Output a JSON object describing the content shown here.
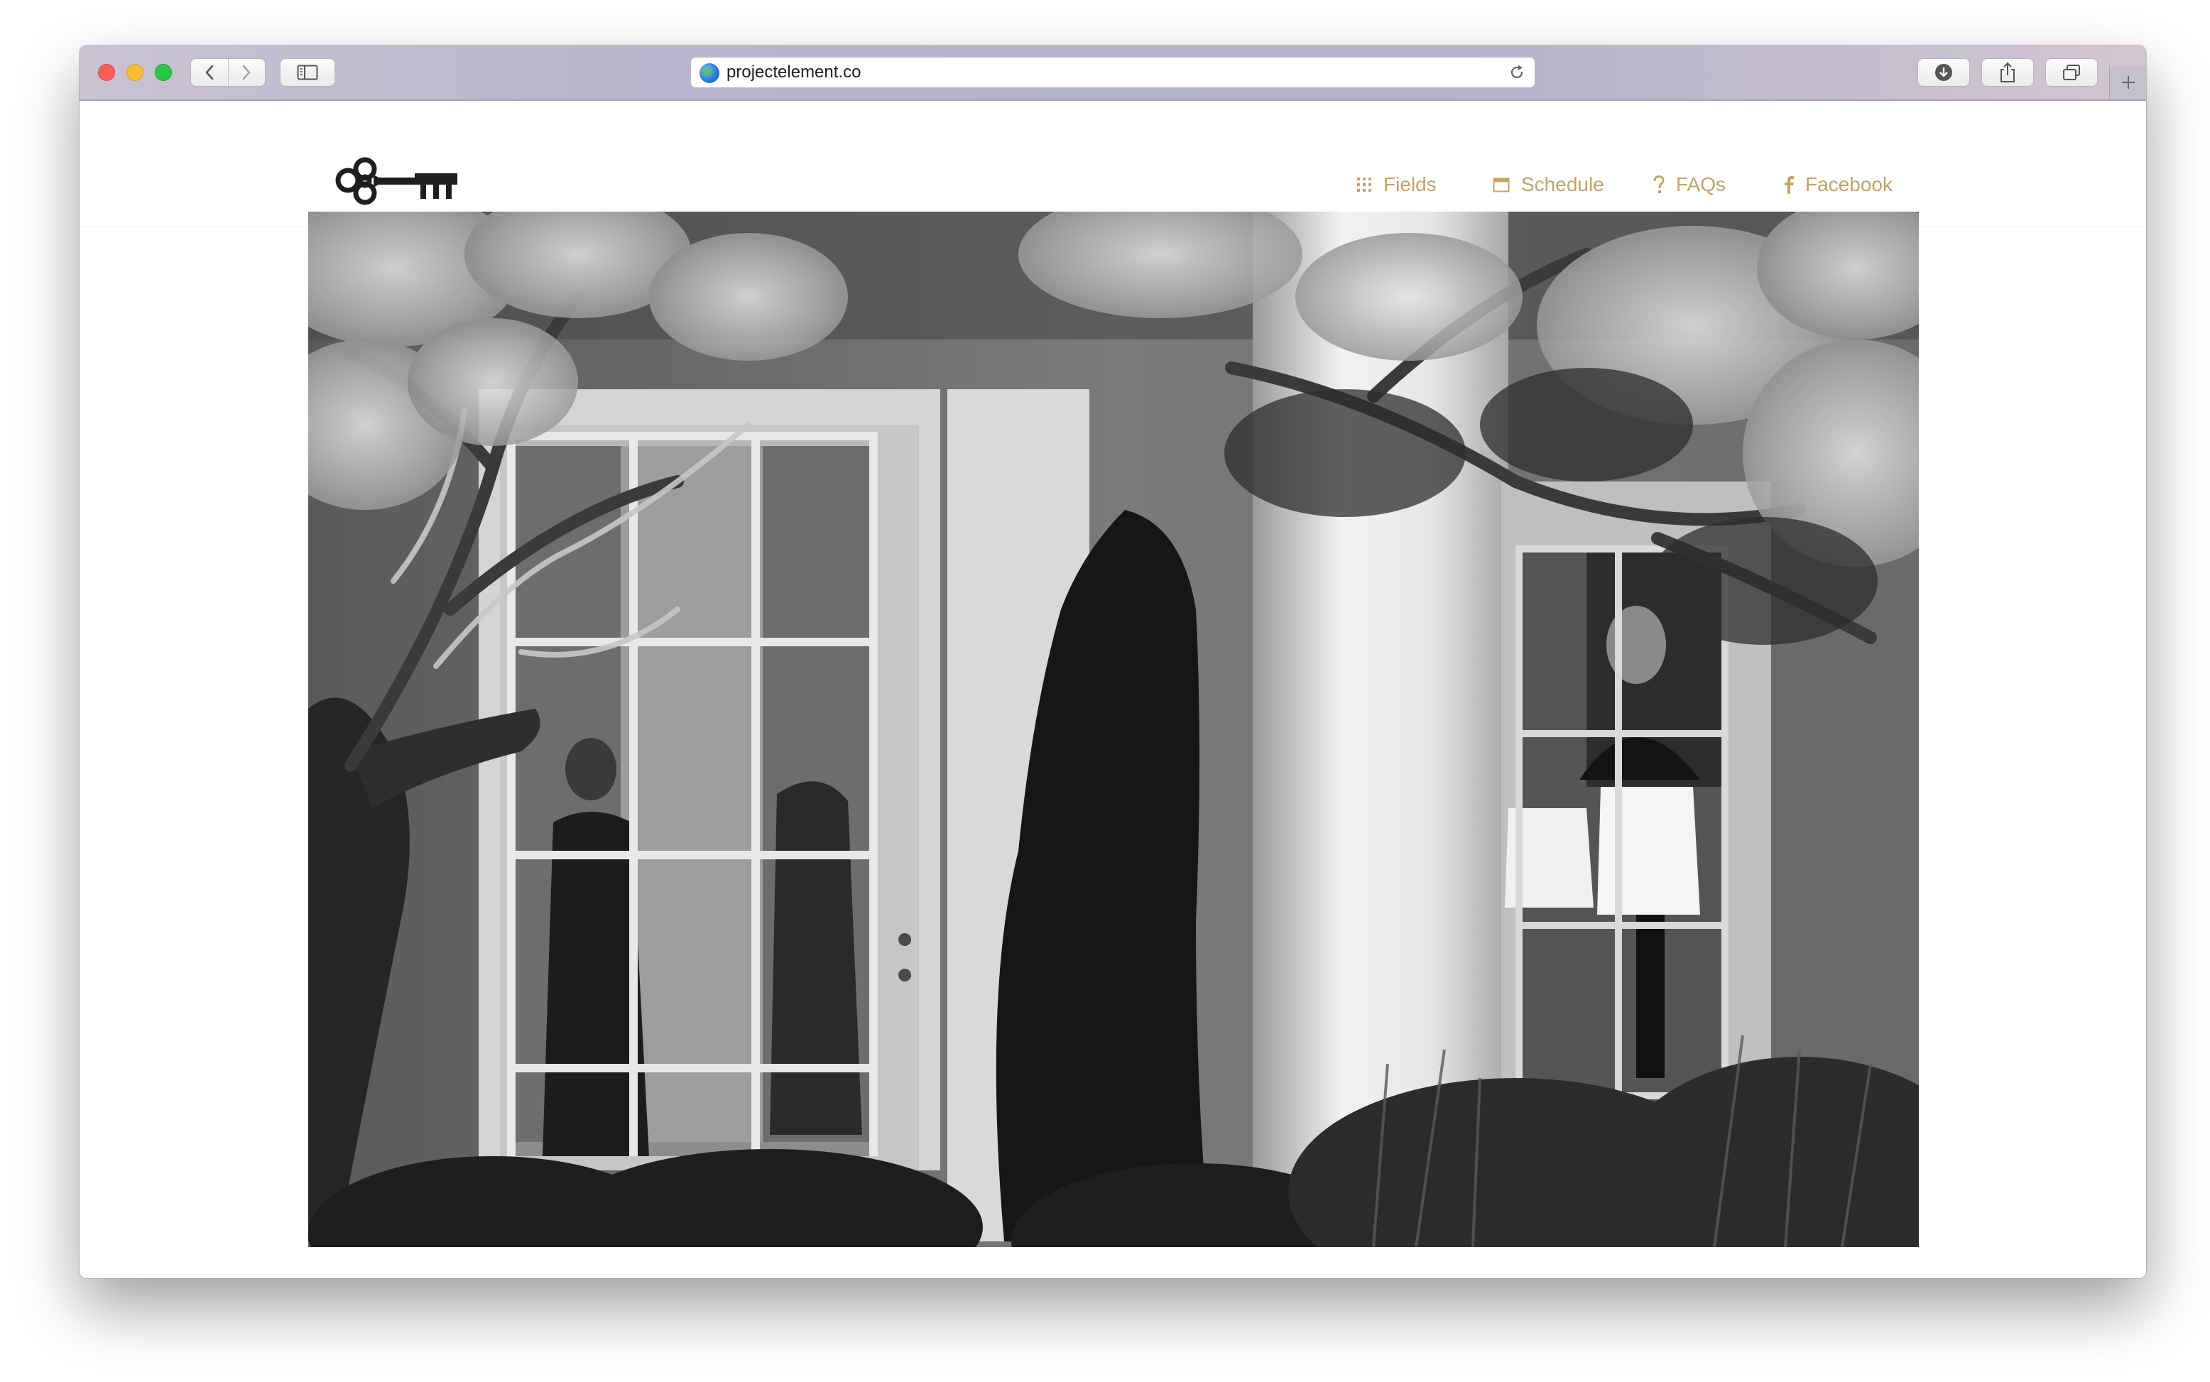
{
  "browser": {
    "url": "projectelement.co",
    "icons": {
      "back": "chevron-left-icon",
      "forward": "chevron-right-icon",
      "sidebar": "sidebar-icon",
      "site": "globe-icon",
      "reload": "reload-icon",
      "downloads": "download-icon",
      "share": "share-icon",
      "tabs": "tabs-overview-icon",
      "new_tab": "plus-icon"
    }
  },
  "site": {
    "logo": "skeleton-key-logo",
    "accent_color": "#c4a464",
    "nav": [
      {
        "label": "Fields",
        "icon": "grid-dots-icon"
      },
      {
        "label": "Schedule",
        "icon": "calendar-icon"
      },
      {
        "label": "FAQs",
        "icon": "question-icon"
      },
      {
        "label": "Facebook",
        "icon": "facebook-icon"
      }
    ]
  },
  "hero": {
    "style": "black-and-white photograph"
  }
}
